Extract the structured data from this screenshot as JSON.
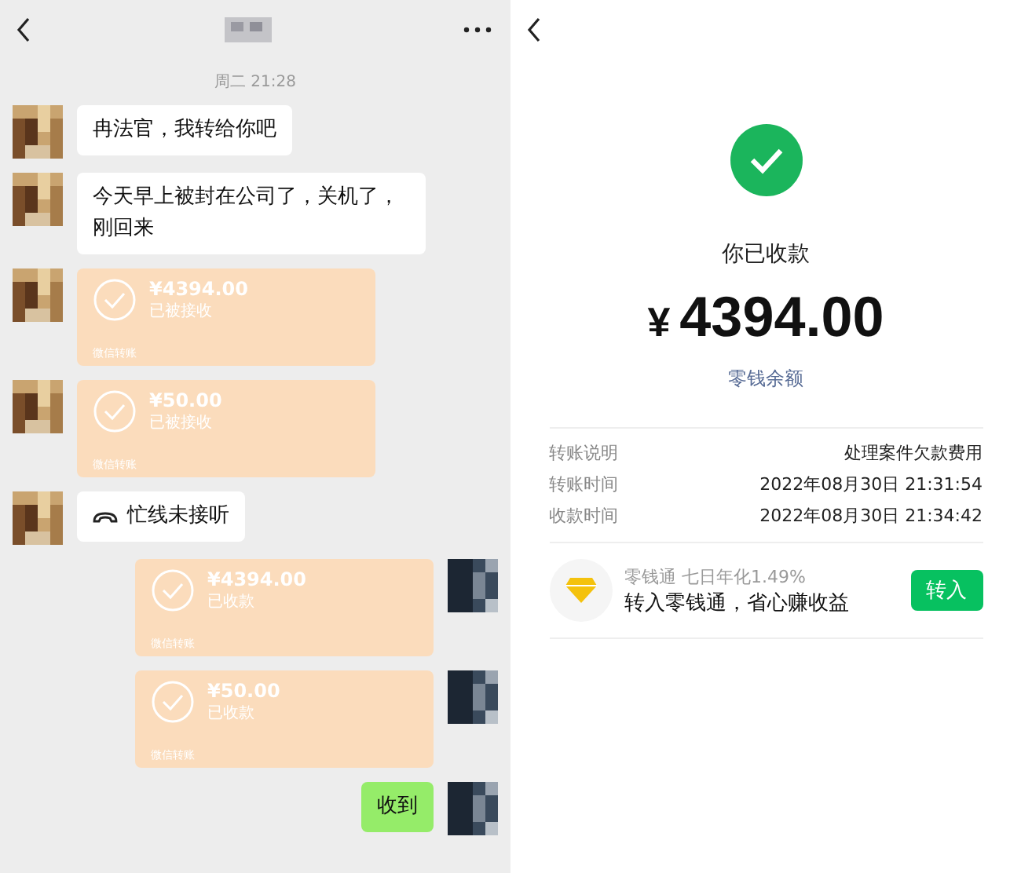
{
  "chat": {
    "timestamp": "周二 21:28",
    "messages": [
      {
        "kind": "text",
        "outgoing": false,
        "text": "冉法官，我转给你吧"
      },
      {
        "kind": "text",
        "outgoing": false,
        "text": "今天早上被封在公司了，关机了，刚回来"
      },
      {
        "kind": "transfer",
        "outgoing": false,
        "amount": "¥4394.00",
        "status": "已被接收",
        "footer": "微信转账"
      },
      {
        "kind": "transfer",
        "outgoing": false,
        "amount": "¥50.00",
        "status": "已被接收",
        "footer": "微信转账"
      },
      {
        "kind": "call",
        "outgoing": false,
        "text": "忙线未接听"
      },
      {
        "kind": "transfer",
        "outgoing": true,
        "amount": "¥4394.00",
        "status": "已收款",
        "footer": "微信转账"
      },
      {
        "kind": "transfer",
        "outgoing": true,
        "amount": "¥50.00",
        "status": "已收款",
        "footer": "微信转账"
      },
      {
        "kind": "text",
        "outgoing": true,
        "text": "收到"
      }
    ]
  },
  "receipt": {
    "status": "你已收款",
    "amount": "4394.00",
    "currency": "¥",
    "balance_link": "零钱余额",
    "details": [
      {
        "label": "转账说明",
        "value": "处理案件欠款费用"
      },
      {
        "label": "转账时间",
        "value": "2022年08月30日 21:31:54"
      },
      {
        "label": "收款时间",
        "value": "2022年08月30日 21:34:42"
      }
    ],
    "promo": {
      "subtitle": "零钱通 七日年化1.49%",
      "title": "转入零钱通，省心赚收益",
      "button": "转入"
    }
  }
}
